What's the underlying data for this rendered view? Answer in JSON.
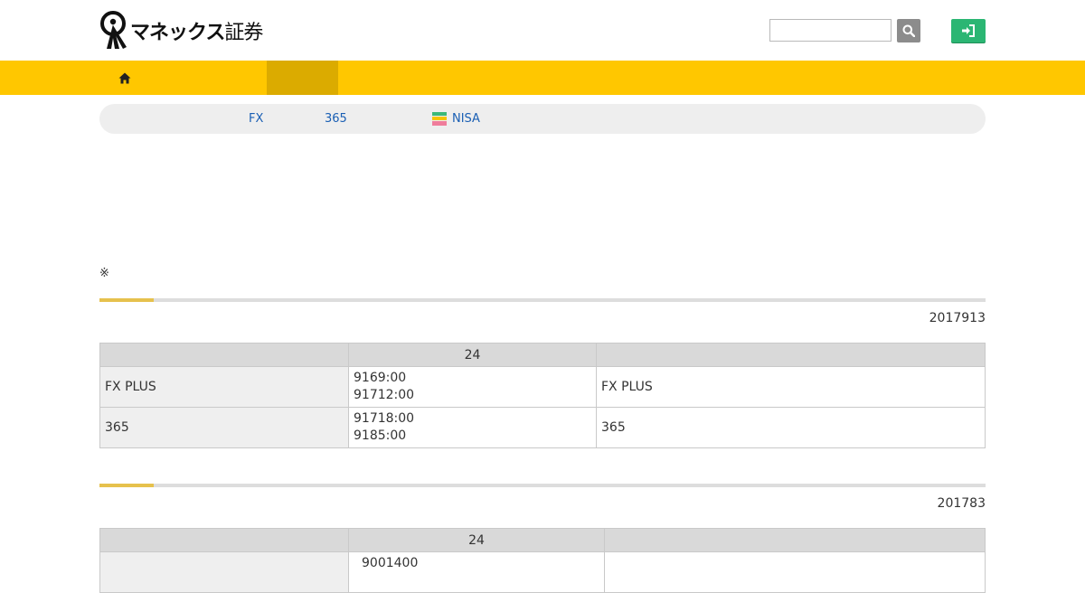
{
  "header": {
    "logo_text": "マネックス",
    "logo_suffix": "証券",
    "search": {
      "value": "",
      "placeholder": ""
    },
    "icons": {
      "search": "search-icon",
      "login": "login-icon"
    }
  },
  "nav": {
    "home_icon": "home-icon"
  },
  "subnav": {
    "links": [
      {
        "label": "FX"
      },
      {
        "label": "365"
      },
      {
        "label": "NISA",
        "icon": "nisa-icon"
      }
    ]
  },
  "note": "※",
  "sections": [
    {
      "date": "2017913",
      "header": [
        "",
        "24",
        ""
      ],
      "rows": [
        {
          "label": "FX PLUS",
          "times": [
            "9169:00",
            "91712:00"
          ],
          "note": "FX PLUS"
        },
        {
          "label": "365",
          "times": [
            "91718:00",
            "9185:00"
          ],
          "note": "365"
        }
      ]
    },
    {
      "date": "201783",
      "header": [
        "",
        "24",
        ""
      ],
      "rows": [
        {
          "label": "",
          "times": [
            "9001400"
          ],
          "note": ""
        }
      ]
    }
  ],
  "colors": {
    "nav_bg": "#ffc700",
    "nav_active": "#dbab00",
    "login_green": "#2bb673",
    "accent": "#e6c14d",
    "link": "#1a5fb4"
  }
}
